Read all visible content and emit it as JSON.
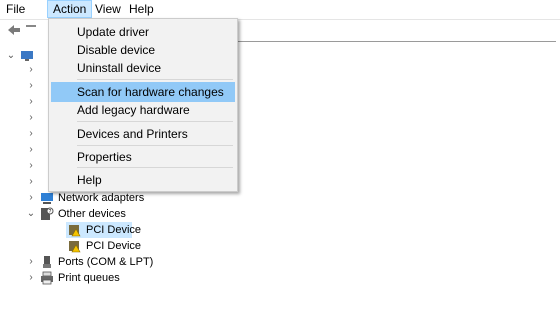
{
  "menubar": {
    "items": [
      {
        "label": "File"
      },
      {
        "label": "Action"
      },
      {
        "label": "View"
      },
      {
        "label": "Help"
      }
    ]
  },
  "action_menu": {
    "items": [
      {
        "label": "Update driver"
      },
      {
        "label": "Disable device"
      },
      {
        "label": "Uninstall device"
      },
      {
        "label": "Scan for hardware changes",
        "highlighted": true
      },
      {
        "label": "Add legacy hardware"
      },
      {
        "label": "Devices and Printers"
      },
      {
        "label": "Properties"
      },
      {
        "label": "Help"
      }
    ]
  },
  "tree": {
    "items": [
      {
        "label": "Network adapters",
        "icon": "network-adapter-icon",
        "expanded": false
      },
      {
        "label": "Other devices",
        "icon": "other-devices-icon",
        "expanded": true
      },
      {
        "label": "PCI Device",
        "icon": "warning-device-icon",
        "selected": true
      },
      {
        "label": "PCI Device",
        "icon": "warning-device-icon"
      },
      {
        "label": "Ports (COM & LPT)",
        "icon": "port-icon",
        "expanded": false
      },
      {
        "label": "Print queues",
        "icon": "printer-icon",
        "expanded": false
      }
    ]
  },
  "colors": {
    "menu_active_bg": "#cce8ff",
    "menu_highlight": "#91c9f7",
    "menu_bg": "#f2f2f2",
    "selection": "#cce8ff"
  }
}
